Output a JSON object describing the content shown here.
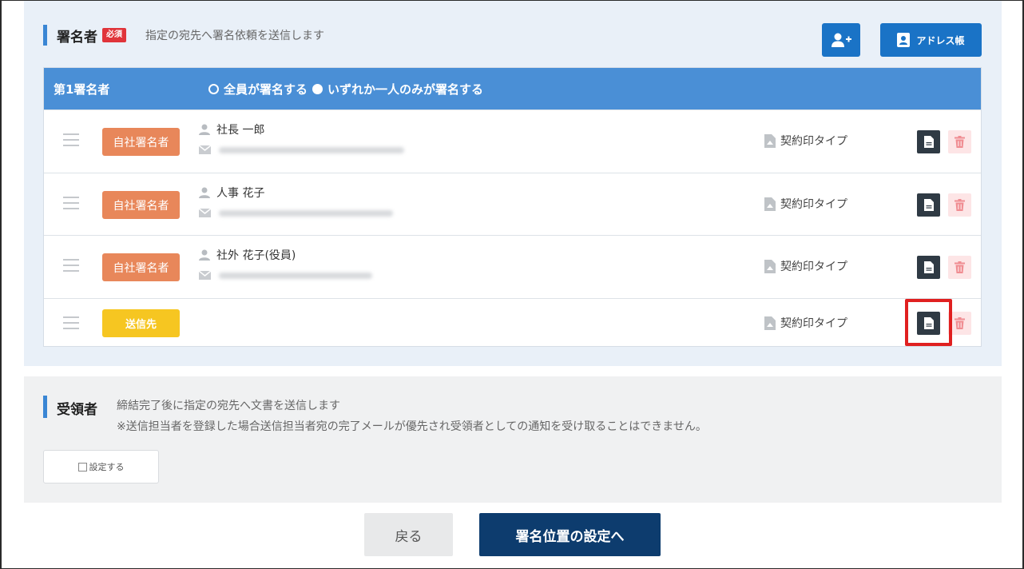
{
  "signer_section": {
    "title": "署名者",
    "required_badge": "必須",
    "description": "指定の宛先へ署名依頼を送信します",
    "add_user_icon": "add-user-icon",
    "address_book_label": "アドレス帳"
  },
  "table": {
    "header_title": "第1署名者",
    "option_all": "全員が署名する",
    "option_one": "いずれか一人のみが署名する",
    "rows": [
      {
        "role": "自社署名者",
        "name": "社長 一郎",
        "stamp": "契約印タイプ"
      },
      {
        "role": "自社署名者",
        "name": "人事 花子",
        "stamp": "契約印タイプ"
      },
      {
        "role": "自社署名者",
        "name": "社外 花子(役員)",
        "stamp": "契約印タイプ"
      },
      {
        "role": "送信先",
        "name": "",
        "stamp": "契約印タイプ"
      }
    ]
  },
  "recipient_section": {
    "title": "受領者",
    "description_line1": "締結完了後に指定の宛先へ文書を送信します",
    "description_line2": "※送信担当者を登録した場合送信担当者宛の完了メールが優先され受領者としての通知を受け取ることはできません。",
    "setting_label": "設定する"
  },
  "footer": {
    "back_label": "戻る",
    "next_label": "署名位置の設定へ"
  },
  "colors": {
    "accent": "#1a73c6",
    "header_blue": "#4a8fd6",
    "own_signer": "#e8875a",
    "send_to": "#f6c621",
    "highlight": "#e02020",
    "primary_dark": "#0d3c6e"
  }
}
